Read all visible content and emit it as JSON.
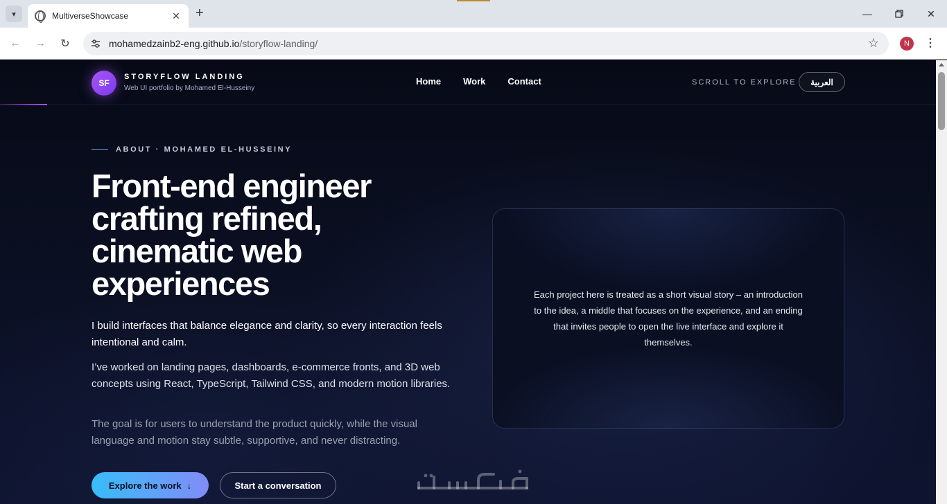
{
  "browser": {
    "tab_title": "MultiverseShowcase",
    "url_host": "mohamedzainb2-eng.github.io",
    "url_path": "/storyflow-landing/",
    "profile_initial": "N",
    "icons": [
      "tab-search-icon",
      "globe-icon",
      "close-icon",
      "plus-icon",
      "minimize-icon",
      "restore-icon",
      "back-icon",
      "forward-icon",
      "reload-icon",
      "site-info-icon",
      "star-icon",
      "menu-icon"
    ]
  },
  "site": {
    "logo_text": "SF",
    "brand_name": "STORYFLOW LANDING",
    "brand_sub": "Web UI portfolio by Mohamed El-Husseiny",
    "nav": [
      "Home",
      "Work",
      "Contact"
    ],
    "scroll_hint": "SCROLL TO EXPLORE",
    "lang_button": "العربية"
  },
  "hero": {
    "eyebrow": "ABOUT · MOHAMED EL-HUSSEINY",
    "headline": "Front-end engineer crafting refined, cinematic web experiences",
    "lead": "I build interfaces that balance elegance and clarity, so every interaction feels intentional and calm.",
    "para2": "I’ve worked on landing pages, dashboards, e-commerce fronts, and 3D web concepts using React, TypeScript, Tailwind CSS, and modern motion libraries.",
    "para3": "The goal is for users to understand the product quickly, while the visual language and motion stay subtle, supportive, and never distracting.",
    "primary_cta": "Explore the work",
    "primary_cta_arrow": "↓",
    "secondary_cta": "Start a conversation",
    "card_text": "Each project here is treated as a short visual story – an introduction to the idea, a middle that focuses on the experience, and an ending that invites people to open the live interface and explore it themselves."
  },
  "colors": {
    "background": "#0a0e1c",
    "accent_purple": "#a855f7",
    "cta_gradient_start": "#38bdf8",
    "cta_gradient_end": "#818cf8",
    "profile": "#c0354b"
  },
  "watermark": "خمسات"
}
